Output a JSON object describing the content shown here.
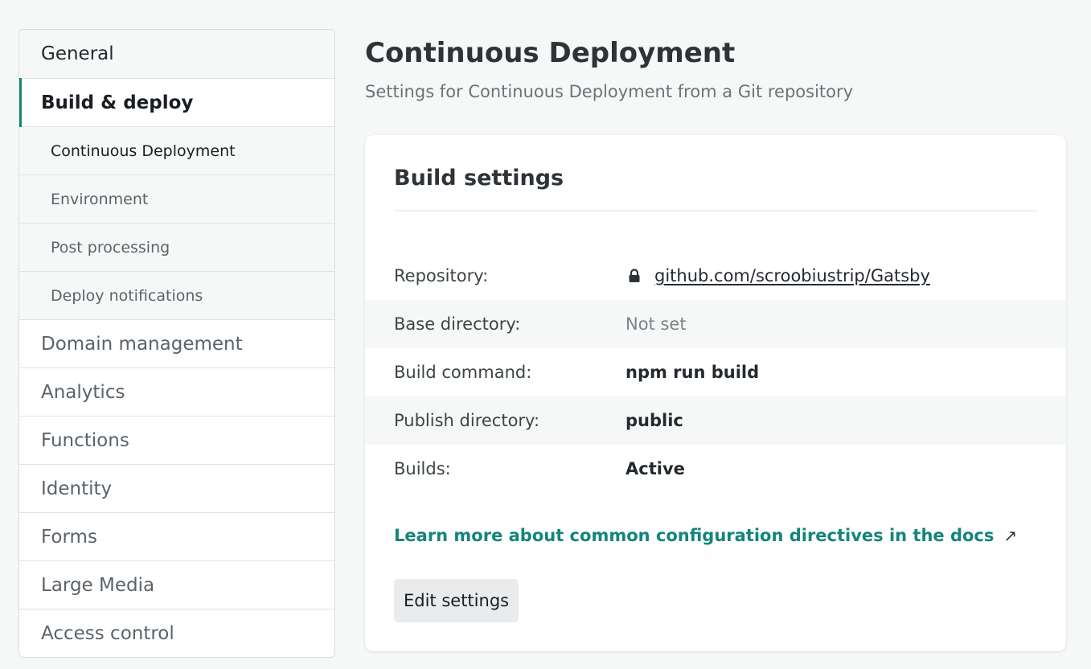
{
  "sidebar": {
    "items": [
      {
        "label": "General"
      },
      {
        "label": "Build & deploy"
      },
      {
        "label": "Domain management"
      },
      {
        "label": "Analytics"
      },
      {
        "label": "Functions"
      },
      {
        "label": "Identity"
      },
      {
        "label": "Forms"
      },
      {
        "label": "Large Media"
      },
      {
        "label": "Access control"
      }
    ],
    "subitems": [
      {
        "label": "Continuous Deployment"
      },
      {
        "label": "Environment"
      },
      {
        "label": "Post processing"
      },
      {
        "label": "Deploy notifications"
      }
    ]
  },
  "main": {
    "title": "Continuous Deployment",
    "subtitle": "Settings for Continuous Deployment from a Git repository"
  },
  "card": {
    "title": "Build settings",
    "rows": [
      {
        "label": "Repository:",
        "value": "github.com/scroobiustrip/Gatsby",
        "icon": "lock-icon"
      },
      {
        "label": "Base directory:",
        "value": "Not set"
      },
      {
        "label": "Build command:",
        "value": "npm run build"
      },
      {
        "label": "Publish directory:",
        "value": "public"
      },
      {
        "label": "Builds:",
        "value": "Active"
      }
    ],
    "docs_link": "Learn more about common configuration directives in the docs",
    "docs_icon": "↗",
    "edit_button": "Edit settings"
  },
  "colors": {
    "accent": "#14857a",
    "background": "#f6f8f8"
  }
}
